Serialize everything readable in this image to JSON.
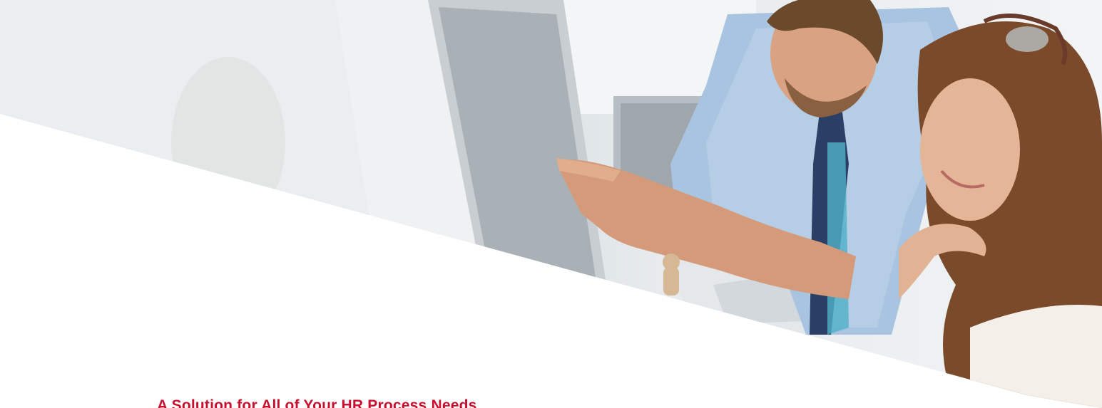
{
  "hero": {
    "image_icon": "office-colleagues-at-computer-photo",
    "headline": "A Solution for All of Your HR Process Needs"
  },
  "colors": {
    "headline": "#c8102e",
    "background": "#ffffff"
  }
}
